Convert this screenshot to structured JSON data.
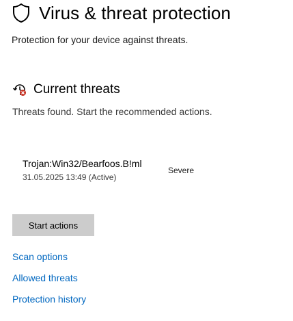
{
  "header": {
    "title": "Virus & threat protection",
    "subtitle": "Protection for your device against threats.",
    "icon": "shield-icon"
  },
  "current_threats": {
    "heading": "Current threats",
    "icon": "threat-clock-icon",
    "description": "Threats found. Start the recommended actions.",
    "threat": {
      "name": "Trojan:Win32/Bearfoos.B!ml",
      "meta": "31.05.2025 13:49 (Active)",
      "severity": "Severe"
    },
    "action_button": "Start actions"
  },
  "links": {
    "scan_options": "Scan options",
    "allowed_threats": "Allowed threats",
    "protection_history": "Protection history"
  },
  "colors": {
    "link": "#0067c0",
    "button_bg": "#cccccc",
    "alert": "#c42b1c"
  }
}
